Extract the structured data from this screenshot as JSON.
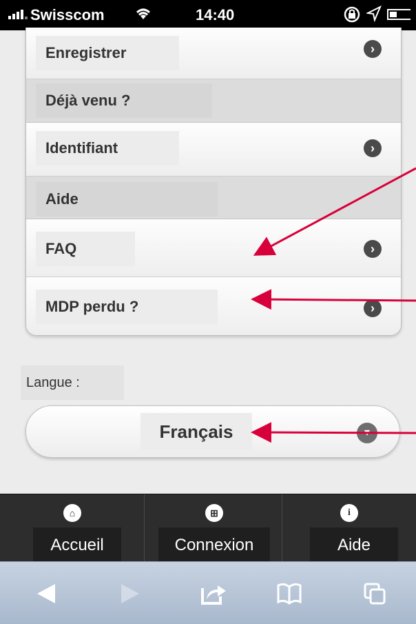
{
  "status_bar": {
    "carrier": "Swisscom",
    "time": "14:40"
  },
  "menu": {
    "register": "Enregistrer",
    "already_section": "Déjà venu ?",
    "login_id": "Identifiant",
    "help_section": "Aide",
    "faq": "FAQ",
    "lost_password": "MDP perdu ?"
  },
  "language": {
    "label": "Langue :",
    "selected": "Français"
  },
  "tabbar": {
    "home": "Accueil",
    "login": "Connexion",
    "help": "Aide"
  },
  "icons": {
    "chevron": "chevron-right-icon",
    "home": "home-icon",
    "grid": "grid-icon",
    "info": "info-icon"
  },
  "colors": {
    "annotation_arrow": "#d8003a",
    "tabbar_bg": "#2d2d2d",
    "safari_bar": "#b7c5d7"
  }
}
